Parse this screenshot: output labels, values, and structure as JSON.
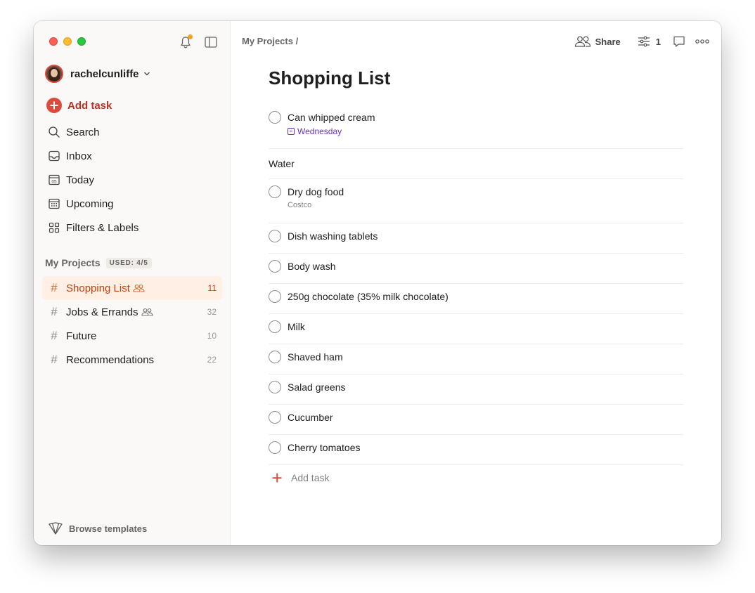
{
  "sidebar": {
    "user": {
      "name": "rachelcunliffe"
    },
    "add_task": "Add task",
    "nav": [
      {
        "label": "Search",
        "icon": "search-icon"
      },
      {
        "label": "Inbox",
        "icon": "inbox-icon"
      },
      {
        "label": "Today",
        "icon": "calendar-today-icon",
        "day": "05"
      },
      {
        "label": "Upcoming",
        "icon": "calendar-grid-icon"
      },
      {
        "label": "Filters & Labels",
        "icon": "filters-grid-icon"
      }
    ],
    "projects_title": "My Projects",
    "projects_used": "USED: 4/5",
    "projects": [
      {
        "label": "Shopping List",
        "count": "11",
        "shared": true,
        "active": true
      },
      {
        "label": "Jobs & Errands",
        "count": "32",
        "shared": true,
        "active": false
      },
      {
        "label": "Future",
        "count": "10",
        "shared": false,
        "active": false
      },
      {
        "label": "Recommendations",
        "count": "22",
        "shared": false,
        "active": false
      }
    ],
    "browse_templates": "Browse templates"
  },
  "header": {
    "breadcrumb": "My Projects /",
    "share": "Share",
    "view_count": "1"
  },
  "main": {
    "title": "Shopping List",
    "add_task": "Add task",
    "tasks": [
      {
        "title": "Can whipped cream",
        "due": "Wednesday"
      },
      {
        "section": "Water"
      },
      {
        "title": "Dry dog food",
        "description": "Costco"
      },
      {
        "title": "Dish washing tablets"
      },
      {
        "title": "Body wash"
      },
      {
        "title": "250g chocolate (35% milk chocolate)"
      },
      {
        "title": "Milk"
      },
      {
        "title": "Shaved ham"
      },
      {
        "title": "Salad greens"
      },
      {
        "title": "Cucumber"
      },
      {
        "title": "Cherry tomatoes"
      }
    ]
  },
  "colors": {
    "accent": "#dc4c3e",
    "active_project_bg": "#ffefe5",
    "due_purple": "#692fc2",
    "notification_dot": "#f2a21b"
  }
}
